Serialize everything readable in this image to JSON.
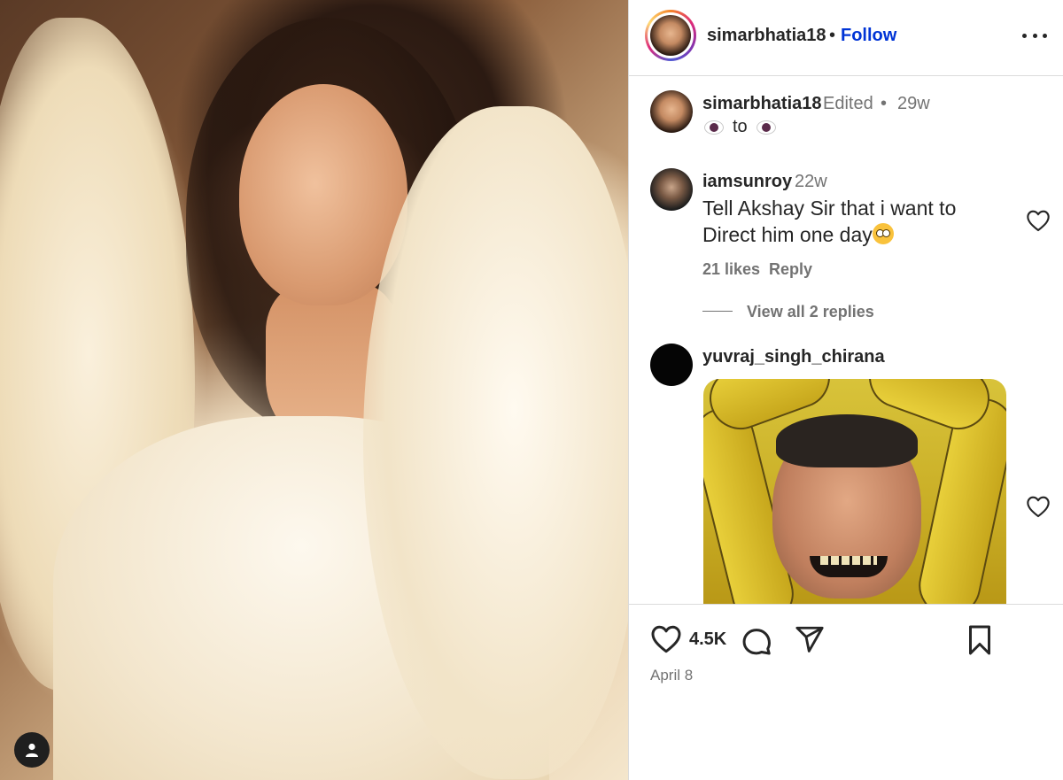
{
  "post": {
    "author": "simarbhatia18",
    "separator": "•",
    "follow_label": "Follow",
    "more_options_icon": "more-options-icon"
  },
  "caption": {
    "user": "simarbhatia18",
    "edited": "Edited",
    "separator": "•",
    "time": "29w",
    "text_middle": "to"
  },
  "comments": [
    {
      "user": "iamsunroy",
      "time": "22w",
      "text": "Tell Akshay Sir that i want to Direct him one day",
      "likes": "21 likes",
      "reply_label": "Reply",
      "view_replies": "View all 2 replies"
    },
    {
      "user": "yuvraj_singh_chirana"
    }
  ],
  "actions": {
    "likes_count": "4.5K",
    "date": "April 8"
  },
  "colors": {
    "follow_blue": "#0034d6",
    "text_primary": "#262626",
    "text_secondary": "#737373"
  }
}
